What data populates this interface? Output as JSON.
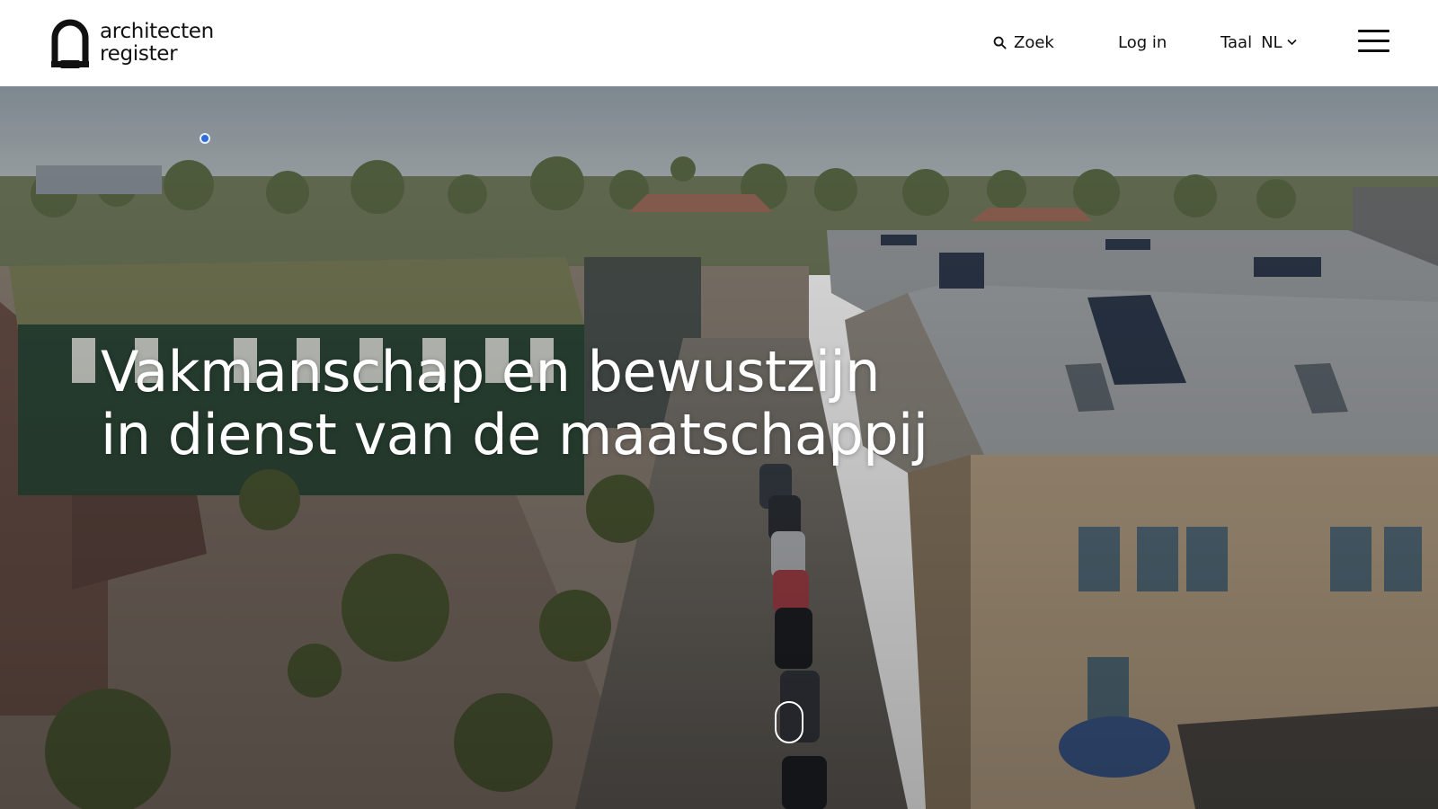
{
  "logo": {
    "line1": "architecten",
    "line2": "register",
    "icon": "arch-logo-icon"
  },
  "nav": {
    "search_label": "Zoek",
    "search_icon": "search-icon",
    "login_label": "Log in",
    "language_label": "Taal",
    "language_value": "NL",
    "language_icon": "chevron-down-icon",
    "menu_icon": "hamburger-menu-icon"
  },
  "hero": {
    "title_line1": "Vakmanschap en bewustzijn",
    "title_line2": "in dienst van de maatschappij",
    "scroll_icon": "scroll-mouse-icon"
  },
  "colors": {
    "text": "#111111",
    "header_bg": "#ffffff",
    "hero_text": "#ffffff",
    "accent_dot": "#2f6cd6"
  }
}
